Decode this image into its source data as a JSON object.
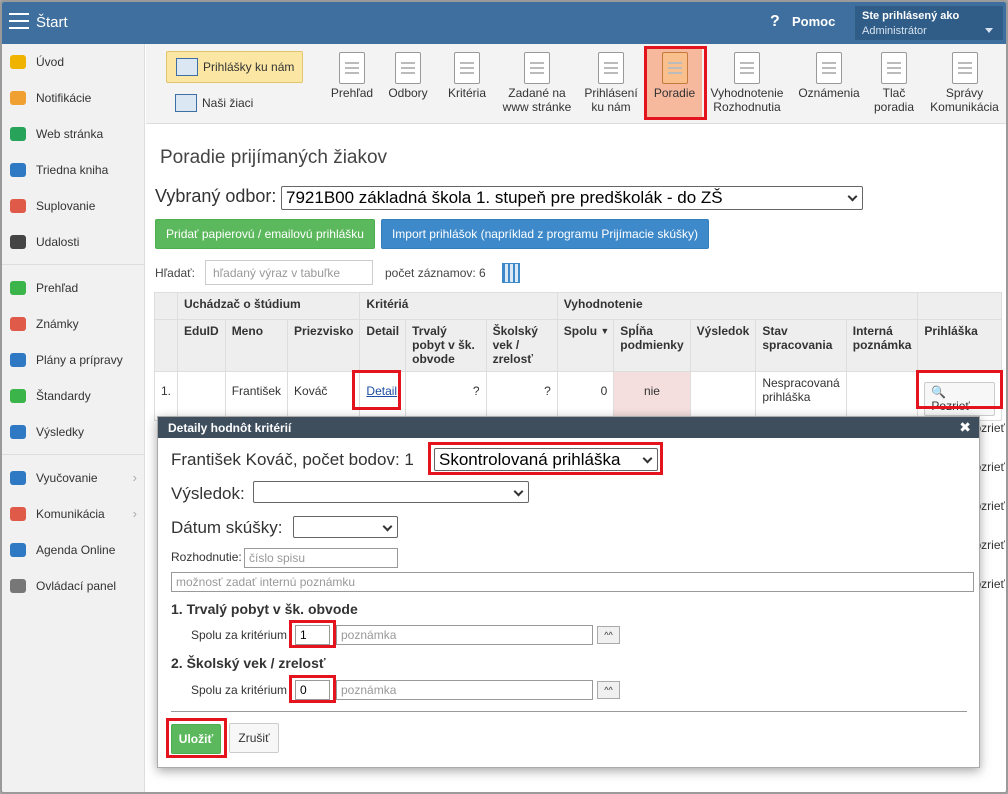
{
  "topbar": {
    "app_title": "Štart",
    "help_label": "Pomoc",
    "user_label": "Ste prihlásený ako",
    "user_name": "Administrátor"
  },
  "sidebar": {
    "items": [
      {
        "label": "Úvod",
        "icon": "star-icon",
        "color": "#f0b400"
      },
      {
        "label": "Notifikácie",
        "icon": "envelope-icon",
        "color": "#f0a030"
      },
      {
        "label": "Web stránka",
        "icon": "home-icon",
        "color": "#27a35a"
      },
      {
        "label": "Triedna kniha",
        "icon": "book-icon",
        "color": "#2f78c4"
      },
      {
        "label": "Suplovanie",
        "icon": "person-icon",
        "color": "#e05a4a"
      },
      {
        "label": "Udalosti",
        "icon": "calendar-icon",
        "color": "#444444"
      },
      {
        "label": "Prehľad",
        "icon": "check-circle-icon",
        "color": "#3bb54a"
      },
      {
        "label": "Známky",
        "icon": "chart-circle-icon",
        "color": "#e05a4a"
      },
      {
        "label": "Plány a prípravy",
        "icon": "briefcase-icon",
        "color": "#2f78c4"
      },
      {
        "label": "Štandardy",
        "icon": "shield-icon",
        "color": "#3bb54a"
      },
      {
        "label": "Výsledky",
        "icon": "bar-chart-icon",
        "color": "#2f78c4"
      },
      {
        "label": "Vyučovanie",
        "icon": "book-open-icon",
        "color": "#2f78c4"
      },
      {
        "label": "Komunikácia",
        "icon": "chat-icon",
        "color": "#e05a4a"
      },
      {
        "label": "Agenda Online",
        "icon": "pen-icon",
        "color": "#2f78c4"
      },
      {
        "label": "Ovládací panel",
        "icon": "gear-icon",
        "color": "#777777"
      }
    ]
  },
  "toolbar": {
    "prihlasky_label": "Prihlášky ku nám",
    "nasi_ziaci_label": "Naši žiaci",
    "tools": [
      {
        "label": "Prehľad"
      },
      {
        "label": "Odbory"
      },
      {
        "label": "Kritéria"
      },
      {
        "label": "Zadané na www stránke"
      },
      {
        "label": "Prihlásení ku nám"
      },
      {
        "label": "Poradie"
      },
      {
        "label": "Vyhodnotenie Rozhodnutia"
      },
      {
        "label": "Oznámenia"
      },
      {
        "label": "Tlač poradia"
      },
      {
        "label": "Správy Komunikácia"
      }
    ]
  },
  "page": {
    "title": "Poradie prijímaných žiakov",
    "odbor_label": "Vybraný odbor:",
    "odbor_value": "7921B00 základná škola 1. stupeň pre predškolák - do ZŠ",
    "btn_add": "Pridať papierovú / emailovú prihlášku",
    "btn_import": "Import prihlášok (napríklad z programu Prijímacie skúšky)",
    "search_label": "Hľadať:",
    "search_placeholder": "hľadaný výraz v tabuľke",
    "count_label": "počet záznamov: 6"
  },
  "table": {
    "groups": [
      "Uchádzač o štúdium",
      "Kritériá",
      "Vyhodnotenie"
    ],
    "headers": [
      "EduID",
      "Meno",
      "Priezvisko",
      "Detail",
      "Trvalý pobyt v šk. obvode",
      "Školský vek / zrelosť",
      "Spolu",
      "Spĺňa podmienky",
      "Výsledok",
      "Stav spracovania",
      "Interná poznámka",
      "Prihláška"
    ],
    "row": {
      "num": "1.",
      "eduid": "",
      "meno": "František",
      "priezvisko": "Kováč",
      "detail": "Detail",
      "pobyt": "?",
      "vek": "?",
      "spolu": "0",
      "splna": "nie",
      "vysledok": "",
      "stav": "Nespracovaná prihláška",
      "poznamka": "",
      "prihlaska": "Pozrieť"
    },
    "right_fragments": [
      "Pozrieť",
      "Pozrieť",
      "Pozrieť",
      "Pozrieť",
      "Pozrieť"
    ]
  },
  "dialog": {
    "title": "Detaily hodnôt kritérií",
    "student": "František Kováč, počet bodov: 1",
    "status_value": "Skontrolovaná prihláška",
    "vysledok_label": "Výsledok:",
    "vysledok_value": "",
    "datum_label": "Dátum skúšky:",
    "datum_value": "",
    "rozhodnutie_label": "Rozhodnutie:",
    "rozhodnutie_placeholder": "číslo spisu",
    "poznamka_placeholder": "možnosť zadať internú poznámku",
    "criteria": [
      {
        "title": "1. Trvalý pobyt v šk. obvode",
        "spolu_label": "Spolu za kritérium",
        "value": "1",
        "note_placeholder": "poznámka"
      },
      {
        "title": "2. Školský vek / zrelosť",
        "spolu_label": "Spolu za kritérium",
        "value": "0",
        "note_placeholder": "poznámka"
      }
    ],
    "save_label": "Uložiť",
    "cancel_label": "Zrušiť"
  }
}
